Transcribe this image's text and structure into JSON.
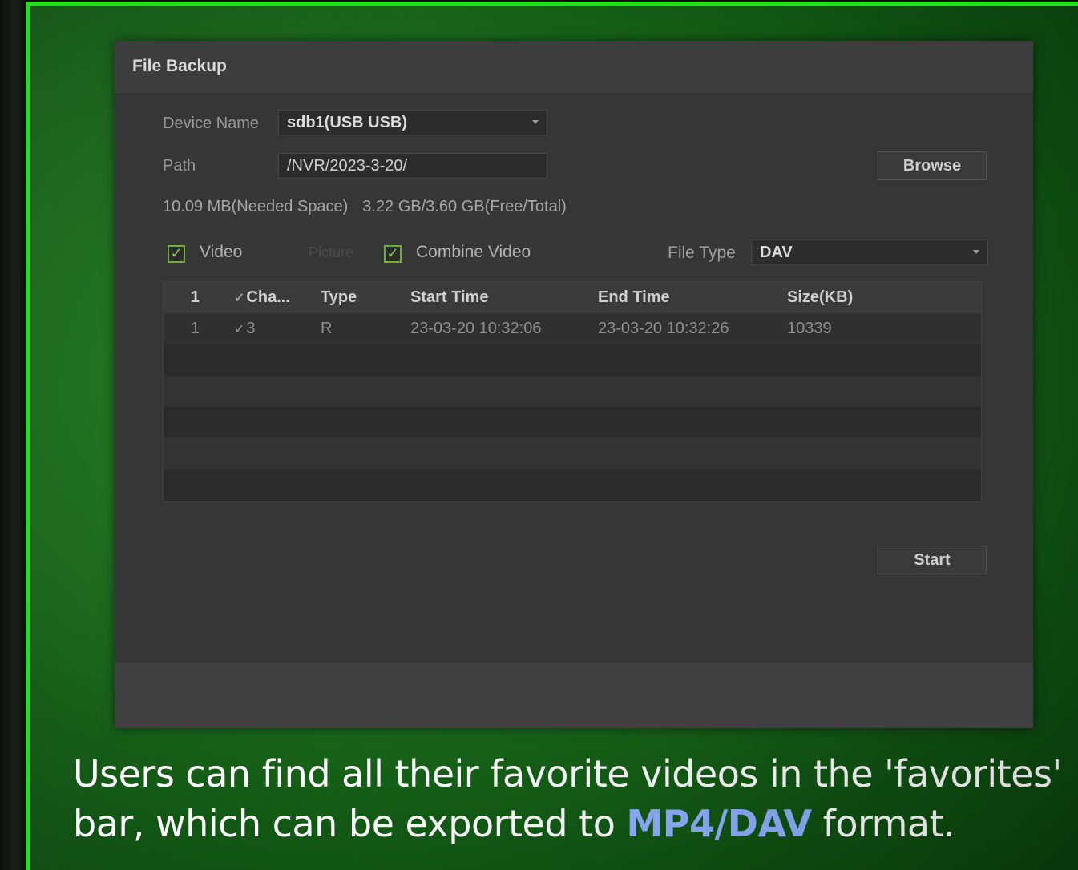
{
  "dialog": {
    "title": "File Backup",
    "device_name_label": "Device Name",
    "device_name_value": "sdb1(USB USB)",
    "path_label": "Path",
    "path_value": "/NVR/2023-3-20/",
    "browse_button": "Browse",
    "needed_space": "10.09 MB(Needed Space)",
    "free_total": "3.22 GB/3.60 GB(Free/Total)",
    "options": {
      "video_label": "Video",
      "video_checked": true,
      "picture_label": "Picture",
      "combine_label": "Combine Video",
      "combine_checked": true,
      "file_type_label": "File Type",
      "file_type_value": "DAV"
    },
    "table": {
      "columns": [
        "1",
        "Cha...",
        "Type",
        "Start Time",
        "End Time",
        "Size(KB)"
      ],
      "rows": [
        {
          "index": "1",
          "channel": "3",
          "type": "R",
          "start_time": "23-03-20 10:32:06",
          "end_time": "23-03-20 10:32:26",
          "size": "10339"
        }
      ]
    },
    "start_button": "Start"
  },
  "caption": {
    "line1": "Users can find all their favorite videos in the 'favorites'",
    "line2_prefix": "bar, which can be exported to ",
    "line2_highlight": "MP4/DAV",
    "line2_suffix": " format.",
    "highlight_color": "#8fb0ff",
    "frame_color": "#21e01d"
  }
}
